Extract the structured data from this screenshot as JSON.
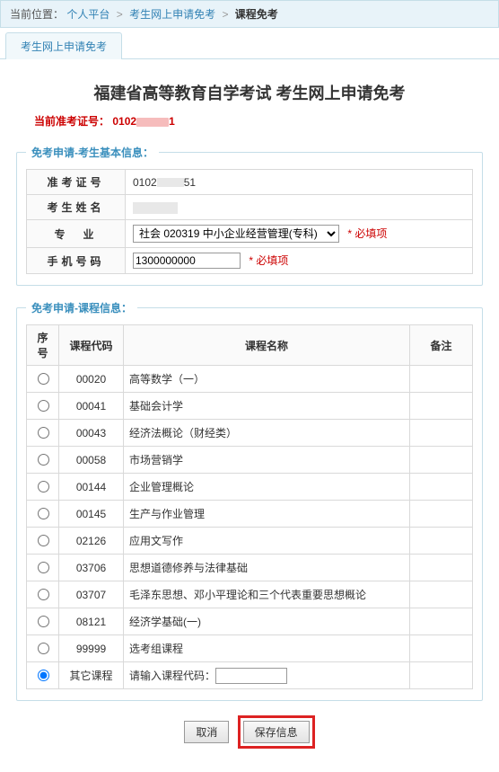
{
  "breadcrumb": {
    "label": "当前位置：",
    "items": [
      "个人平台",
      "考生网上申请免考"
    ],
    "current": "课程免考"
  },
  "tab": {
    "label": "考生网上申请免考"
  },
  "title": "福建省高等教育自学考试 考生网上申请免考",
  "ticket": {
    "label": "当前准考证号：",
    "prefix": "0102",
    "suffix": "1"
  },
  "info_legend": "免考申请-考生基本信息：",
  "info": {
    "rows": [
      {
        "label": "准考证号",
        "value_prefix": "0102",
        "value_suffix": "51"
      },
      {
        "label": "考生姓名",
        "value_prefix": "",
        "value_suffix": ""
      },
      {
        "label": "专　业"
      },
      {
        "label": "手机号码"
      }
    ],
    "major_value": "社会 020319 中小企业经营管理(专科)",
    "phone_value": "1300000000",
    "required_text": "必填项"
  },
  "course_legend": "免考申请-课程信息：",
  "course_headers": [
    "序号",
    "课程代码",
    "课程名称",
    "备注"
  ],
  "courses": [
    {
      "code": "00020",
      "name": "高等数学（一）"
    },
    {
      "code": "00041",
      "name": "基础会计学"
    },
    {
      "code": "00043",
      "name": "经济法概论（财经类）"
    },
    {
      "code": "00058",
      "name": "市场营销学"
    },
    {
      "code": "00144",
      "name": "企业管理概论"
    },
    {
      "code": "00145",
      "name": "生产与作业管理"
    },
    {
      "code": "02126",
      "name": "应用文写作"
    },
    {
      "code": "03706",
      "name": "思想道德修养与法律基础"
    },
    {
      "code": "03707",
      "name": "毛泽东思想、邓小平理论和三个代表重要思想概论"
    },
    {
      "code": "08121",
      "name": "经济学基础(一)"
    },
    {
      "code": "99999",
      "name": "选考组课程"
    }
  ],
  "other_course": {
    "label": "其它课程",
    "prompt": "请输入课程代码：",
    "value": ""
  },
  "buttons": {
    "cancel": "取消",
    "save": "保存信息"
  }
}
